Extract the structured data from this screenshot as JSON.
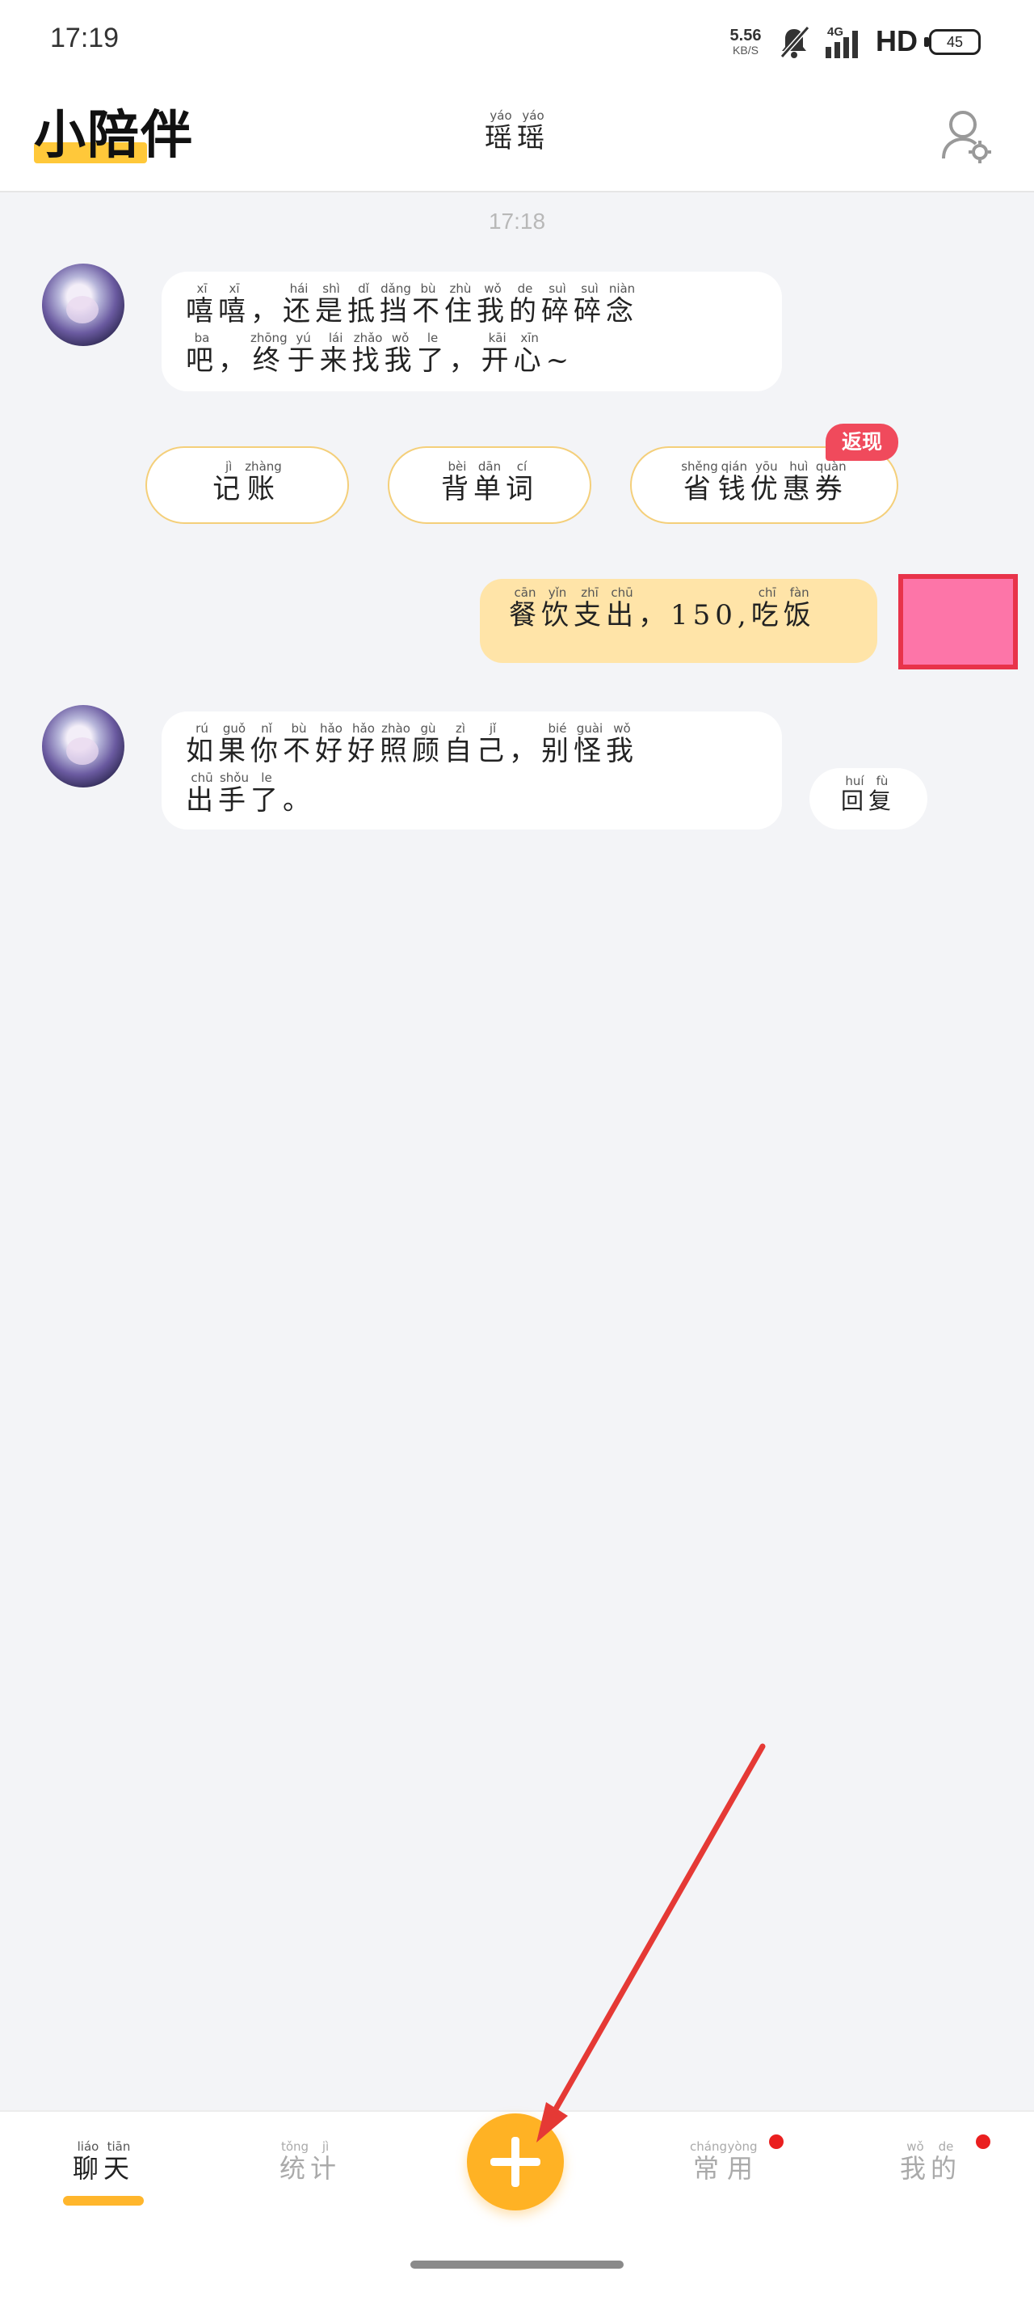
{
  "status_bar": {
    "time": "17:19",
    "net_speed_value": "5.56",
    "net_speed_unit": "KB/S",
    "network": "4G",
    "hd": "HD",
    "battery": "45"
  },
  "header": {
    "logo": "小陪伴",
    "title": [
      {
        "c": "瑶",
        "p": "yáo"
      },
      {
        "c": "瑶",
        "p": "yáo"
      }
    ],
    "settings_icon": "user-settings-icon"
  },
  "chat": {
    "timestamp": "17:18",
    "msg1_line1": [
      {
        "c": "嘻",
        "p": "xī"
      },
      {
        "c": "嘻",
        "p": "xī"
      },
      {
        "c": "，",
        "p": ""
      },
      {
        "c": "还",
        "p": "hái"
      },
      {
        "c": "是",
        "p": "shì"
      },
      {
        "c": "抵",
        "p": "dǐ"
      },
      {
        "c": "挡",
        "p": "dǎng"
      },
      {
        "c": "不",
        "p": "bù"
      },
      {
        "c": "住",
        "p": "zhù"
      },
      {
        "c": "我",
        "p": "wǒ"
      },
      {
        "c": "的",
        "p": "de"
      },
      {
        "c": "碎",
        "p": "suì"
      },
      {
        "c": "碎",
        "p": "suì"
      },
      {
        "c": "念",
        "p": "niàn"
      }
    ],
    "msg1_line2": [
      {
        "c": "吧",
        "p": "ba"
      },
      {
        "c": "，",
        "p": ""
      },
      {
        "c": "终",
        "p": "zhōng"
      },
      {
        "c": "于",
        "p": "yú"
      },
      {
        "c": "来",
        "p": "lái"
      },
      {
        "c": "找",
        "p": "zhǎo"
      },
      {
        "c": "我",
        "p": "wǒ"
      },
      {
        "c": "了",
        "p": "le"
      },
      {
        "c": "，",
        "p": ""
      },
      {
        "c": "开",
        "p": "kāi"
      },
      {
        "c": "心",
        "p": "xīn"
      },
      {
        "c": "~",
        "p": ""
      }
    ],
    "quick_actions": [
      [
        {
          "c": "记",
          "p": "jì"
        },
        {
          "c": "账",
          "p": "zhàng"
        }
      ],
      [
        {
          "c": "背",
          "p": "bèi"
        },
        {
          "c": "单",
          "p": "dān"
        },
        {
          "c": "词",
          "p": "cí"
        }
      ],
      [
        {
          "c": "省",
          "p": "shěng"
        },
        {
          "c": "钱",
          "p": "qián"
        },
        {
          "c": "优",
          "p": "yōu"
        },
        {
          "c": "惠",
          "p": "huì"
        },
        {
          "c": "券",
          "p": "quàn"
        }
      ]
    ],
    "cashback_badge": "返现",
    "user_msg": [
      {
        "c": "餐",
        "p": "cān"
      },
      {
        "c": "饮",
        "p": "yǐn"
      },
      {
        "c": "支",
        "p": "zhī"
      },
      {
        "c": "出",
        "p": "chū"
      },
      {
        "c": "，",
        "p": ""
      },
      {
        "c": "150,",
        "p": ""
      },
      {
        "c": "吃",
        "p": "chī"
      },
      {
        "c": "饭",
        "p": "fàn"
      }
    ],
    "msg2_line1": [
      {
        "c": "如",
        "p": "rú"
      },
      {
        "c": "果",
        "p": "guǒ"
      },
      {
        "c": "你",
        "p": "nǐ"
      },
      {
        "c": "不",
        "p": "bù"
      },
      {
        "c": "好",
        "p": "hǎo"
      },
      {
        "c": "好",
        "p": "hǎo"
      },
      {
        "c": "照",
        "p": "zhào"
      },
      {
        "c": "顾",
        "p": "gù"
      },
      {
        "c": "自",
        "p": "zì"
      },
      {
        "c": "己",
        "p": "jǐ"
      },
      {
        "c": "，",
        "p": ""
      },
      {
        "c": "别",
        "p": "bié"
      },
      {
        "c": "怪",
        "p": "guài"
      },
      {
        "c": "我",
        "p": "wǒ"
      }
    ],
    "msg2_line2": [
      {
        "c": "出",
        "p": "chū"
      },
      {
        "c": "手",
        "p": "shǒu"
      },
      {
        "c": "了",
        "p": "le"
      },
      {
        "c": "。",
        "p": ""
      }
    ],
    "reply": [
      {
        "c": "回",
        "p": "huí"
      },
      {
        "c": "复",
        "p": "fù"
      }
    ]
  },
  "bottom_nav": {
    "items": [
      [
        {
          "c": "聊",
          "p": "liáo"
        },
        {
          "c": "天",
          "p": "tiān"
        }
      ],
      [
        {
          "c": "统",
          "p": "tǒng"
        },
        {
          "c": "计",
          "p": "jì"
        }
      ],
      [
        {
          "c": "常",
          "p": "cháng"
        },
        {
          "c": "用",
          "p": "yòng"
        }
      ],
      [
        {
          "c": "我",
          "p": "wǒ"
        },
        {
          "c": "的",
          "p": "de"
        }
      ]
    ]
  },
  "colors": {
    "accent": "#ffb224",
    "user_bubble": "#ffe4a8",
    "badge": "#f04a5c",
    "annotation": "#e53935"
  }
}
